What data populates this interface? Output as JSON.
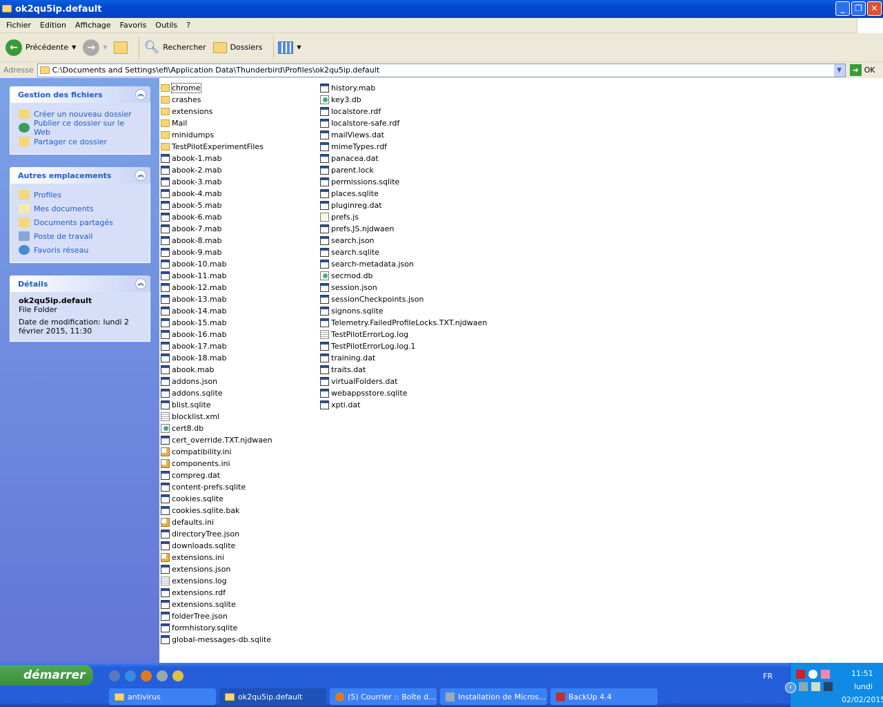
{
  "window": {
    "title": "ok2qu5ip.default"
  },
  "menu": [
    "Fichier",
    "Edition",
    "Affichage",
    "Favoris",
    "Outils",
    "?"
  ],
  "toolbar": {
    "back": "Précédente",
    "search": "Rechercher",
    "folders": "Dossiers"
  },
  "address": {
    "label": "Adresse",
    "path": "C:\\Documents and Settings\\efi\\Application Data\\Thunderbird\\Profiles\\ok2qu5ip.default",
    "go": "OK"
  },
  "tasks_panel": {
    "title": "Gestion des fichiers",
    "items": [
      "Créer un nouveau dossier",
      "Publier ce dossier sur le Web",
      "Partager ce dossier"
    ]
  },
  "places_panel": {
    "title": "Autres emplacements",
    "items": [
      "Profiles",
      "Mes documents",
      "Documents partagés",
      "Poste de travail",
      "Favoris réseau"
    ]
  },
  "details_panel": {
    "title": "Détails",
    "name": "ok2qu5ip.default",
    "type": "File Folder",
    "modified": "Date de modification: lundi 2 février 2015, 11:30"
  },
  "files_col1": [
    [
      "chrome",
      "folder"
    ],
    [
      "crashes",
      "folder"
    ],
    [
      "extensions",
      "folder"
    ],
    [
      "Mail",
      "folder"
    ],
    [
      "minidumps",
      "folder"
    ],
    [
      "TestPilotExperimentFiles",
      "folder"
    ],
    [
      "abook-1.mab",
      "file"
    ],
    [
      "abook-2.mab",
      "file"
    ],
    [
      "abook-3.mab",
      "file"
    ],
    [
      "abook-4.mab",
      "file"
    ],
    [
      "abook-5.mab",
      "file"
    ],
    [
      "abook-6.mab",
      "file"
    ],
    [
      "abook-7.mab",
      "file"
    ],
    [
      "abook-8.mab",
      "file"
    ],
    [
      "abook-9.mab",
      "file"
    ],
    [
      "abook-10.mab",
      "file"
    ],
    [
      "abook-11.mab",
      "file"
    ],
    [
      "abook-12.mab",
      "file"
    ],
    [
      "abook-13.mab",
      "file"
    ],
    [
      "abook-14.mab",
      "file"
    ],
    [
      "abook-15.mab",
      "file"
    ],
    [
      "abook-16.mab",
      "file"
    ],
    [
      "abook-17.mab",
      "file"
    ],
    [
      "abook-18.mab",
      "file"
    ],
    [
      "abook.mab",
      "file"
    ],
    [
      "addons.json",
      "file"
    ],
    [
      "addons.sqlite",
      "file"
    ],
    [
      "blist.sqlite",
      "file"
    ],
    [
      "blocklist.xml",
      "txt"
    ],
    [
      "cert8.db",
      "db"
    ],
    [
      "cert_override.TXT.njdwaen",
      "file"
    ],
    [
      "compatibility.ini",
      "ini"
    ],
    [
      "components.ini",
      "ini"
    ],
    [
      "compreg.dat",
      "file"
    ],
    [
      "content-prefs.sqlite",
      "file"
    ],
    [
      "cookies.sqlite",
      "file"
    ],
    [
      "cookies.sqlite.bak",
      "file"
    ],
    [
      "defaults.ini",
      "ini"
    ],
    [
      "directoryTree.json",
      "file"
    ],
    [
      "downloads.sqlite",
      "file"
    ],
    [
      "extensions.ini",
      "ini"
    ],
    [
      "extensions.json",
      "file"
    ],
    [
      "extensions.log",
      "txt"
    ],
    [
      "extensions.rdf",
      "file"
    ],
    [
      "extensions.sqlite",
      "file"
    ],
    [
      "folderTree.json",
      "file"
    ],
    [
      "formhistory.sqlite",
      "file"
    ],
    [
      "global-messages-db.sqlite",
      "file"
    ]
  ],
  "files_col2": [
    [
      "history.mab",
      "file"
    ],
    [
      "key3.db",
      "db"
    ],
    [
      "localstore.rdf",
      "file"
    ],
    [
      "localstore-safe.rdf",
      "file"
    ],
    [
      "mailViews.dat",
      "file"
    ],
    [
      "mimeTypes.rdf",
      "file"
    ],
    [
      "panacea.dat",
      "file"
    ],
    [
      "parent.lock",
      "file"
    ],
    [
      "permissions.sqlite",
      "file"
    ],
    [
      "places.sqlite",
      "file"
    ],
    [
      "pluginreg.dat",
      "file"
    ],
    [
      "prefs.js",
      "js"
    ],
    [
      "prefs.JS.njdwaen",
      "file"
    ],
    [
      "search.json",
      "file"
    ],
    [
      "search.sqlite",
      "file"
    ],
    [
      "search-metadata.json",
      "file"
    ],
    [
      "secmod.db",
      "db"
    ],
    [
      "session.json",
      "file"
    ],
    [
      "sessionCheckpoints.json",
      "file"
    ],
    [
      "signons.sqlite",
      "file"
    ],
    [
      "Telemetry.FailedProfileLocks.TXT.njdwaen",
      "file"
    ],
    [
      "TestPilotErrorLog.log",
      "txt"
    ],
    [
      "TestPilotErrorLog.log.1",
      "file"
    ],
    [
      "training.dat",
      "file"
    ],
    [
      "traits.dat",
      "file"
    ],
    [
      "virtualFolders.dat",
      "file"
    ],
    [
      "webappsstore.sqlite",
      "file"
    ],
    [
      "xpti.dat",
      "file"
    ]
  ],
  "taskbar": {
    "start": "démarrer",
    "tasks": [
      "antivirus",
      "ok2qu5ip.default",
      "(5) Courrier :: Boîte d...",
      "Installation de Micros...",
      "BackUp 4.4"
    ],
    "language": "FR",
    "time": "11:51",
    "day": "lundi",
    "date": "02/02/2015"
  }
}
